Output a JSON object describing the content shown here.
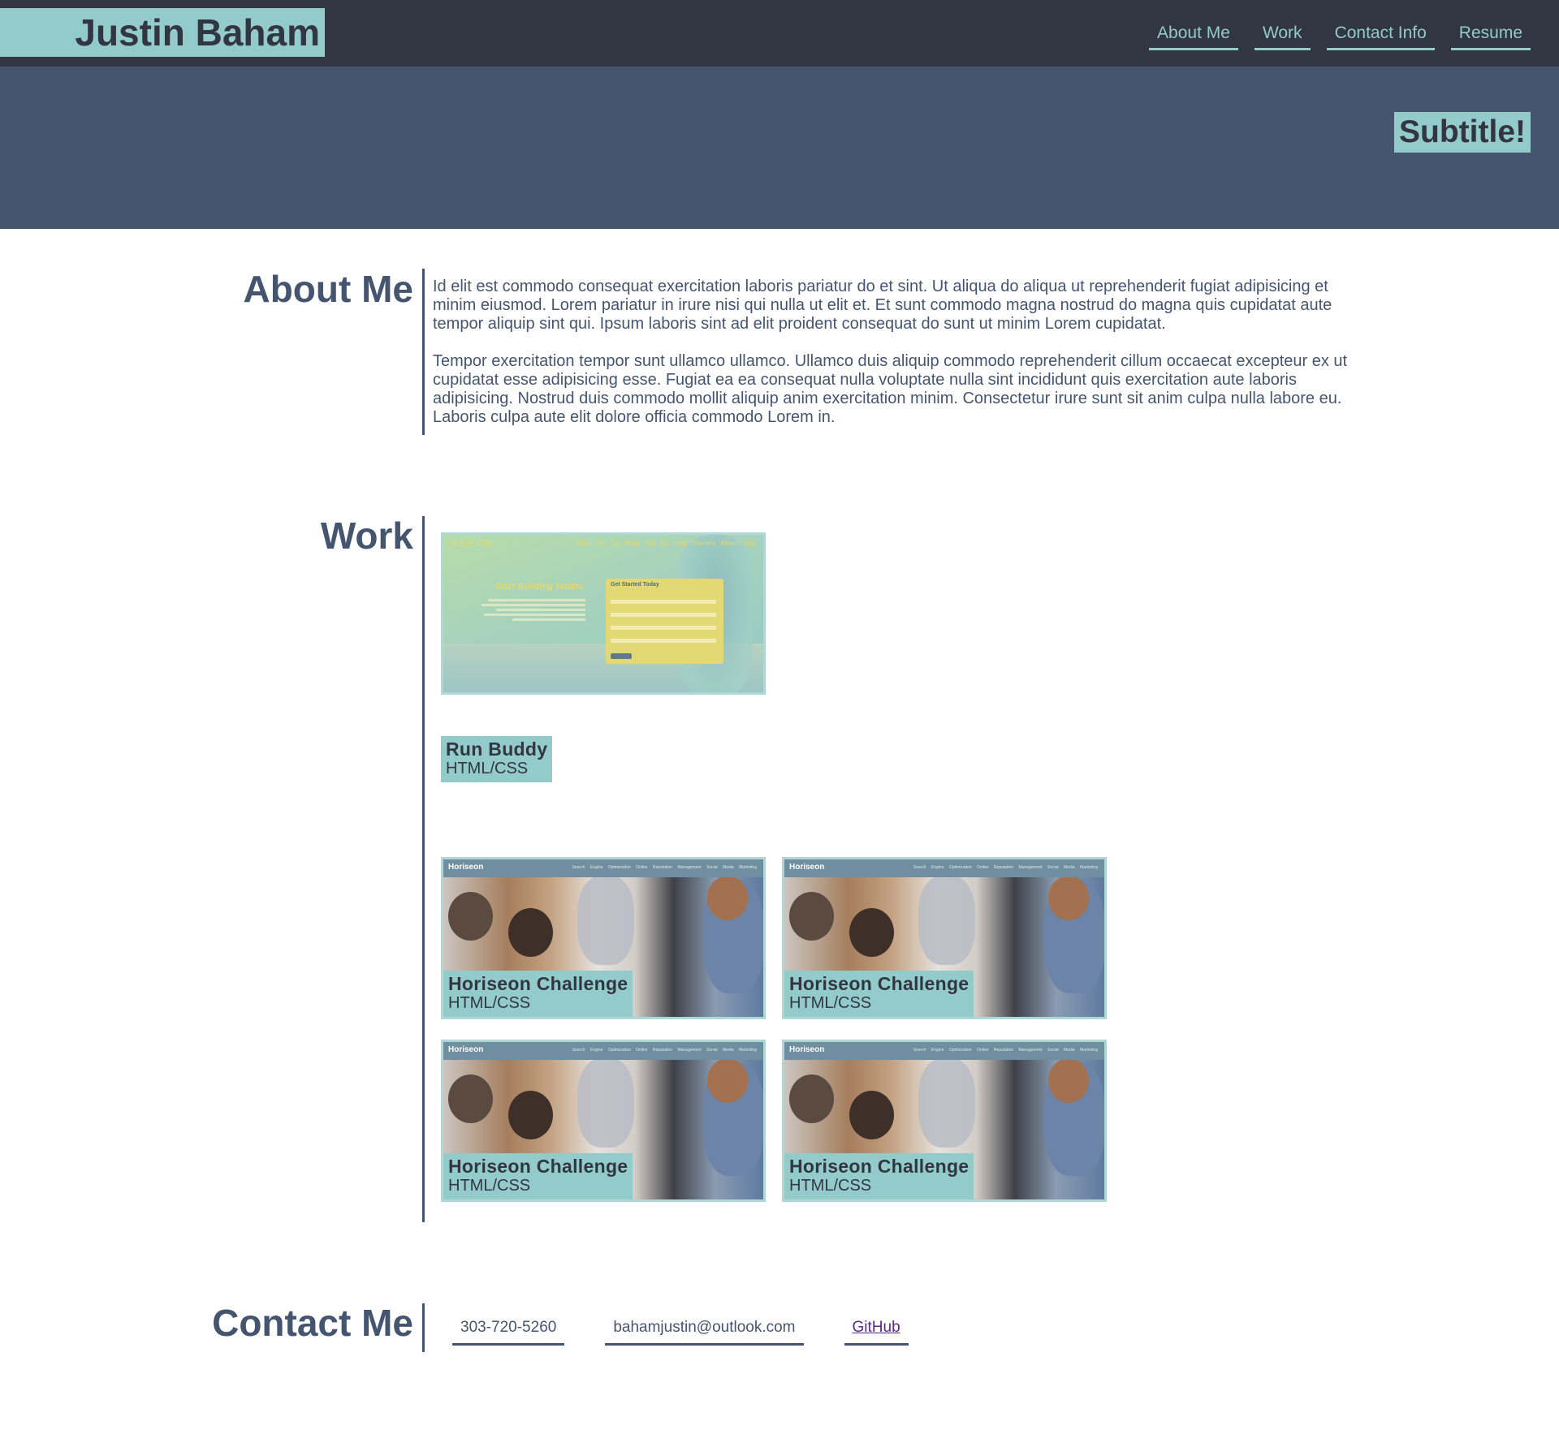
{
  "header": {
    "name": "Justin Baham",
    "nav": [
      "About Me",
      "Work",
      "Contact Info",
      "Resume"
    ],
    "subtitle": "Subtitle!"
  },
  "about": {
    "title": "About Me",
    "paragraphs": [
      "Id elit est commodo consequat exercitation laboris pariatur do et sint. Ut aliqua do aliqua ut reprehenderit fugiat adipisicing et minim eiusmod. Lorem pariatur in irure nisi qui nulla ut elit et. Et sunt commodo magna nostrud do magna quis cupidatat aute tempor aliquip sint qui. Ipsum laboris sint ad elit proident consequat do sunt ut minim Lorem cupidatat.",
      "Tempor exercitation tempor sunt ullamco ullamco. Ullamco duis aliquip commodo reprehenderit cillum occaecat excepteur ex ut cupidatat esse adipisicing esse. Fugiat ea ea consequat nulla voluptate nulla sint incididunt quis exercitation aute laboris adipisicing. Nostrud duis commodo mollit aliquip anim exercitation minim. Consectetur irure sunt sit anim culpa nulla labore eu. Laboris culpa aute elit dolore officia commodo Lorem in."
    ]
  },
  "work": {
    "title": "Work",
    "featured": {
      "name": "Run Buddy",
      "tech": "HTML/CSS",
      "screenshot": {
        "logo": "RUN BUDDY",
        "nav": "What We Do What You Do Your Trainers Reach Out",
        "headline": "Start Building Habits.",
        "form_title": "Get Started Today"
      }
    },
    "projects": [
      {
        "name": "Horiseon Challenge",
        "tech": "HTML/CSS",
        "screenshot_logo": "Horiseon",
        "screenshot_nav": "Search Engine Optimization Online Reputation Management Social Media Marketing"
      },
      {
        "name": "Horiseon Challenge",
        "tech": "HTML/CSS",
        "screenshot_logo": "Horiseon",
        "screenshot_nav": "Search Engine Optimization Online Reputation Management Social Media Marketing"
      },
      {
        "name": "Horiseon Challenge",
        "tech": "HTML/CSS",
        "screenshot_logo": "Horiseon",
        "screenshot_nav": "Search Engine Optimization Online Reputation Management Social Media Marketing"
      },
      {
        "name": "Horiseon Challenge",
        "tech": "HTML/CSS",
        "screenshot_logo": "Horiseon",
        "screenshot_nav": "Search Engine Optimization Online Reputation Management Social Media Marketing"
      }
    ]
  },
  "contact": {
    "title": "Contact Me",
    "phone": "303-720-5260",
    "email": "bahamjustin@outlook.com",
    "github": "GitHub"
  },
  "colors": {
    "dark": "#323643",
    "primary": "#45556f",
    "accent": "#93cbca",
    "link_visited": "#552a82"
  }
}
